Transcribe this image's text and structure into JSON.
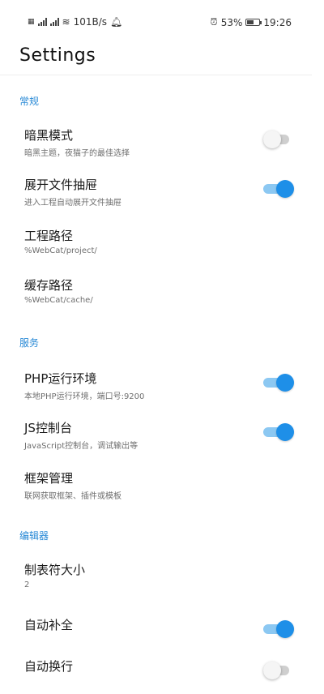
{
  "status_bar": {
    "network_speed": "101B/s",
    "battery_percent": "53%",
    "battery_level": 0.53,
    "time": "19:26",
    "icons": [
      "sim-icon",
      "signal-icon",
      "wifi-icon",
      "notification-bell-icon",
      "alarm-icon",
      "battery-icon"
    ]
  },
  "page": {
    "title": "Settings"
  },
  "colors": {
    "accent": "#1e8fe8",
    "section_header": "#2a8ad6",
    "toggle_off_track": "#cfcfcf",
    "toggle_on_track": "#8cc8f2"
  },
  "sections": [
    {
      "header": "常规",
      "items": [
        {
          "title": "暗黑模式",
          "subtitle": "暗黑主题，夜猫子的最佳选择",
          "toggle": false
        },
        {
          "title": "展开文件抽屉",
          "subtitle": "进入工程自动展开文件抽屉",
          "toggle": true
        },
        {
          "title": "工程路径",
          "subtitle": "%WebCat/project/"
        },
        {
          "title": "缓存路径",
          "subtitle": "%WebCat/cache/"
        }
      ]
    },
    {
      "header": "服务",
      "items": [
        {
          "title": "PHP运行环境",
          "subtitle": "本地PHP运行环境，端口号:9200",
          "toggle": true
        },
        {
          "title": "JS控制台",
          "subtitle": "JavaScript控制台，调试输出等",
          "toggle": true
        },
        {
          "title": "框架管理",
          "subtitle": "联网获取框架、插件或模板"
        }
      ]
    },
    {
      "header": "编辑器",
      "items": [
        {
          "title": "制表符大小",
          "subtitle": "2"
        },
        {
          "title": "自动补全",
          "toggle": true
        },
        {
          "title": "自动换行",
          "toggle": false
        }
      ]
    }
  ]
}
